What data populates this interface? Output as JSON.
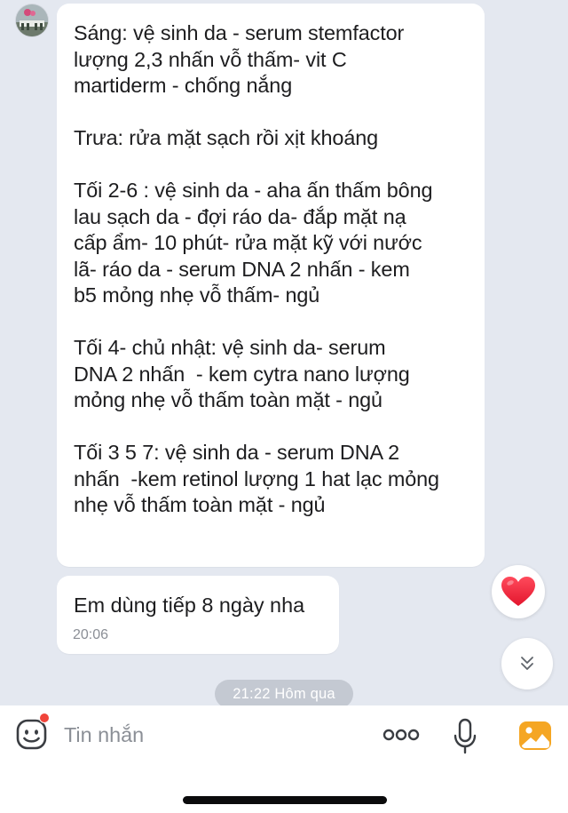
{
  "conversation": {
    "messages": [
      {
        "text": "Sáng: vệ sinh da - serum stemfactor\nlượng 2,3 nhấn vỗ thấm- vit C\nmartiderm - chống nắng\n\nTrưa: rửa mặt sạch rồi xịt khoáng\n\nTối 2-6 : vệ sinh da - aha ấn thấm bông\nlau sạch da - đợi ráo da- đắp mặt nạ\ncấp ẩm- 10 phút- rửa mặt kỹ với nước\nlã- ráo da - serum DNA 2 nhấn - kem\nb5 mỏng nhẹ vỗ thấm- ngủ\n\nTối 4- chủ nhật: vệ sinh da- serum\nDNA 2 nhấn  - kem cytra nano lượng\nmỏng nhẹ vỗ thấm toàn mặt - ngủ\n\nTối 3 5 7: vệ sinh da - serum DNA 2\nnhấn  -kem retinol lượng 1 hat lạc mỏng\nnhẹ vỗ thấm toàn mặt - ngủ"
      },
      {
        "text": "Em dùng tiếp 8 ngày nha",
        "time": "20:06"
      }
    ],
    "date_separator": "21:22 Hôm qua"
  },
  "reaction": {
    "icon": "heart-icon",
    "color": "#f0243a"
  },
  "scroll_down": {
    "icon": "double-chevron-down-icon"
  },
  "composer": {
    "placeholder": "Tin nhắn",
    "value": "",
    "emoji_icon": "emoji-sticker-icon",
    "more_icon": "more-dots-icon",
    "mic_icon": "microphone-icon",
    "photo_icon": "photo-gallery-icon",
    "notification_dot_color": "#f0443a",
    "photo_icon_color": "#f5a623"
  },
  "colors": {
    "chat_background": "#e4e8f0",
    "bubble_background": "#ffffff",
    "time_text": "#8b8f96",
    "date_pill_background": "#c4c9d2"
  }
}
